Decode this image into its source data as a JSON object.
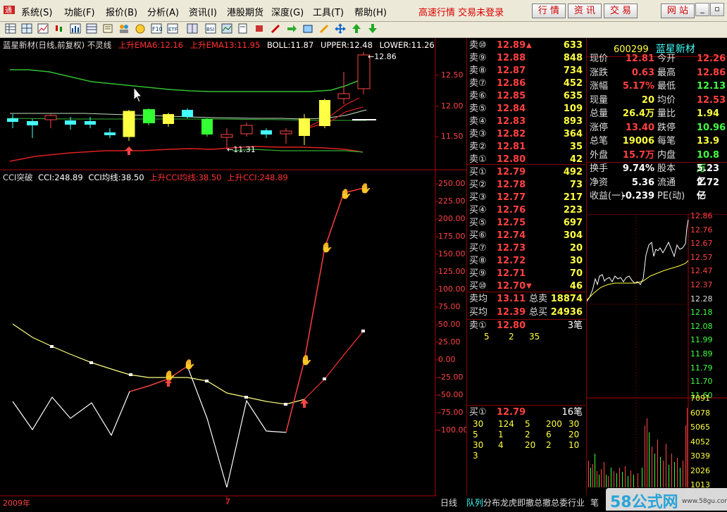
{
  "menubar": {
    "items": [
      "系统(S)",
      "功能(F)",
      "报价(B)",
      "分析(A)",
      "资讯(I)",
      "港股期货",
      "深度(G)",
      "工具(T)",
      "帮助(H)"
    ],
    "market_status": "高速行情 交易未登录",
    "buttons": [
      "行 情",
      "资 讯",
      "交 易",
      "网 站"
    ],
    "window_controls": [
      "minimize-icon",
      "restore-icon",
      "close-icon"
    ]
  },
  "toolbar": {
    "icons": [
      "table-icon",
      "grid-icon",
      "line-chart-icon",
      "candle-chart-icon",
      "tick-chart-icon",
      "table2-icon",
      "news-icon",
      "people-icon",
      "graph-icon",
      "f10-icon",
      "etf-icon",
      "multi-window-icon",
      "bsi-icon",
      "chart-board-icon",
      "notes-icon",
      "brush-icon",
      "export-icon",
      "pen-icon",
      "move-icon",
      "up-arrow-icon",
      "down-arrow-icon"
    ]
  },
  "chart": {
    "title": "蓝星新材(日线,前复权) 不灵线",
    "indicators": [
      {
        "text": "上升EMA6:12.16",
        "color": "#ff3030"
      },
      {
        "text": "上升EMA13:11.95",
        "color": "#ff3030"
      },
      {
        "text": "BOLL:11.87",
        "color": "#ffffff"
      },
      {
        "text": "UPPER:12.48",
        "color": "#ffffff"
      },
      {
        "text": "LOWER:11.26",
        "color": "#ffffff"
      }
    ],
    "price_axis": [
      "12.50",
      "12.00",
      "11.50"
    ],
    "high_label": "12.86",
    "low_label": "11.31",
    "cci_title": "CCI突破",
    "cci_indicators": [
      {
        "text": "CCI:248.89",
        "color": "#ffffff"
      },
      {
        "text": "CCI均线:38.50",
        "color": "#ffffff"
      },
      {
        "text": "上升CCI均线:38.50",
        "color": "#ff3030"
      },
      {
        "text": "上升CCI:248.89",
        "color": "#ff3030"
      }
    ],
    "cci_axis": [
      "250.00",
      "225.00",
      "200.00",
      "175.00",
      "150.00",
      "125.00",
      "100.00",
      "75.00",
      "50.00",
      "25.00",
      "0.00",
      "-25.00",
      "-50.00",
      "-75.00",
      "-100.00"
    ],
    "year_label": "2009年",
    "month_label": "7",
    "period_tab": "日线"
  },
  "book": {
    "sell": [
      {
        "label": "卖⑩",
        "price": "12.89",
        "vol": "633",
        "arrow": "▲"
      },
      {
        "label": "卖⑨",
        "price": "12.88",
        "vol": "848",
        "arrow": ""
      },
      {
        "label": "卖⑧",
        "price": "12.87",
        "vol": "734",
        "arrow": ""
      },
      {
        "label": "卖⑦",
        "price": "12.86",
        "vol": "452",
        "arrow": ""
      },
      {
        "label": "卖⑥",
        "price": "12.85",
        "vol": "635",
        "arrow": ""
      },
      {
        "label": "卖⑤",
        "price": "12.84",
        "vol": "109",
        "arrow": ""
      },
      {
        "label": "卖④",
        "price": "12.83",
        "vol": "893",
        "arrow": ""
      },
      {
        "label": "卖③",
        "price": "12.82",
        "vol": "364",
        "arrow": ""
      },
      {
        "label": "卖②",
        "price": "12.81",
        "vol": "35",
        "arrow": ""
      },
      {
        "label": "卖①",
        "price": "12.80",
        "vol": "42",
        "arrow": ""
      }
    ],
    "buy": [
      {
        "label": "买①",
        "price": "12.79",
        "vol": "492",
        "arrow": ""
      },
      {
        "label": "买②",
        "price": "12.78",
        "vol": "73",
        "arrow": ""
      },
      {
        "label": "买③",
        "price": "12.77",
        "vol": "217",
        "arrow": ""
      },
      {
        "label": "买④",
        "price": "12.76",
        "vol": "223",
        "arrow": ""
      },
      {
        "label": "买⑤",
        "price": "12.75",
        "vol": "697",
        "arrow": ""
      },
      {
        "label": "买⑥",
        "price": "12.74",
        "vol": "304",
        "arrow": ""
      },
      {
        "label": "买⑦",
        "price": "12.73",
        "vol": "20",
        "arrow": ""
      },
      {
        "label": "买⑧",
        "price": "12.72",
        "vol": "30",
        "arrow": ""
      },
      {
        "label": "买⑨",
        "price": "12.71",
        "vol": "70",
        "arrow": ""
      },
      {
        "label": "买⑩",
        "price": "12.70",
        "vol": "46",
        "arrow": "▼"
      }
    ],
    "avg_sell_label": "卖均",
    "avg_sell": "13.11",
    "total_sell_label": "总卖",
    "total_sell": "18874",
    "avg_buy_label": "买均",
    "avg_buy": "12.39",
    "total_buy_label": "总买",
    "total_buy": "24936",
    "sell1_detail": {
      "label": "卖①",
      "price": "12.80",
      "count": "3笔",
      "orders": [
        "5",
        "2",
        "35"
      ]
    },
    "buy1_detail": {
      "label": "买①",
      "price": "12.79",
      "count": "16笔",
      "orders": [
        [
          "30",
          "124",
          "5",
          "200",
          "30"
        ],
        [
          "5",
          "1",
          "2",
          "6",
          "20"
        ],
        [
          "30",
          "4",
          "20",
          "2",
          "10"
        ],
        [
          "3"
        ]
      ]
    }
  },
  "quote": {
    "code": "600299",
    "name": "蓝星新材",
    "rows": [
      {
        "l1": "现价",
        "v1": "12.81",
        "l2": "今开",
        "v2": "12.26"
      },
      {
        "l1": "涨跌",
        "v1": "0.63",
        "l2": "最高",
        "v2": "12.86"
      },
      {
        "l1": "涨幅",
        "v1": "5.17%",
        "l2": "最低",
        "v2": "12.13"
      },
      {
        "l1": "现量",
        "v1": "20",
        "l2": "均价",
        "v2": "12.53"
      },
      {
        "l1": "总量",
        "v1": "26.4万",
        "l2": "量比",
        "v2": "1.94"
      },
      {
        "l1": "涨停",
        "v1": "13.40",
        "l2": "跌停",
        "v2": "10.96"
      },
      {
        "l1": "总笔",
        "v1": "19006",
        "l2": "每笔",
        "v2": "13.9"
      },
      {
        "l1": "外盘",
        "v1": "15.7万",
        "l2": "内盘",
        "v2": "10.8万"
      },
      {
        "l1": "换手",
        "v1": "9.74%",
        "l2": "股本",
        "v2": "5.23亿"
      },
      {
        "l1": "净资",
        "v1": "5.36",
        "l2": "流通",
        "v2": "2.72亿"
      },
      {
        "l1": "收益(一)",
        "v1": "-0.239",
        "l2": "PE(动)",
        "v2": "一"
      }
    ]
  },
  "mini": {
    "price_axis": [
      "12.86",
      "12.76",
      "12.67",
      "12.57",
      "12.47",
      "12.37",
      "12.28",
      "12.18",
      "12.08",
      "11.99",
      "11.89",
      "11.79",
      "11.70",
      "11.60"
    ],
    "vol_axis": [
      "7091",
      "6078",
      "5065",
      "4052",
      "3039",
      "2026",
      "1013"
    ]
  },
  "tabs": [
    "日线",
    "队列",
    "分布",
    "龙虎",
    "即撤",
    "总撤",
    "总委",
    "行业",
    "笔"
  ],
  "watermark": "58公式网 www.58gu.com",
  "colors": {
    "red": "#ff3030",
    "yellow": "#ffff40",
    "green": "#40ff40",
    "cyan": "#40ffff",
    "grid": "#800000"
  }
}
